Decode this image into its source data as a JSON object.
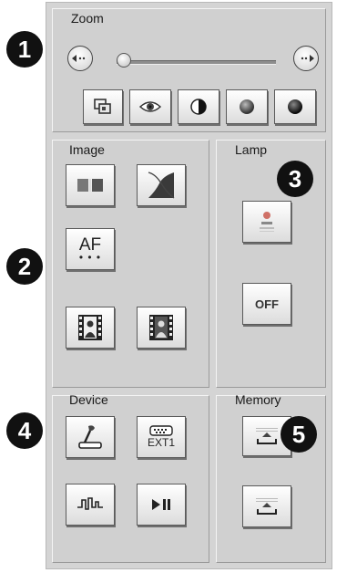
{
  "zoom": {
    "title": "Zoom",
    "slider_value": 0.0,
    "buttons": [
      {
        "icon": "zoom-frame-icon"
      },
      {
        "icon": "eye-icon"
      },
      {
        "icon": "contrast-icon"
      },
      {
        "icon": "dark-sphere-icon"
      },
      {
        "icon": "black-sphere-icon"
      }
    ]
  },
  "image": {
    "title": "Image",
    "af_label": "AF"
  },
  "lamp": {
    "title": "Lamp",
    "off_label": "OFF"
  },
  "device": {
    "title": "Device",
    "ext_label": "EXT1"
  },
  "memory": {
    "title": "Memory"
  },
  "callouts": [
    "1",
    "2",
    "3",
    "4",
    "5"
  ]
}
